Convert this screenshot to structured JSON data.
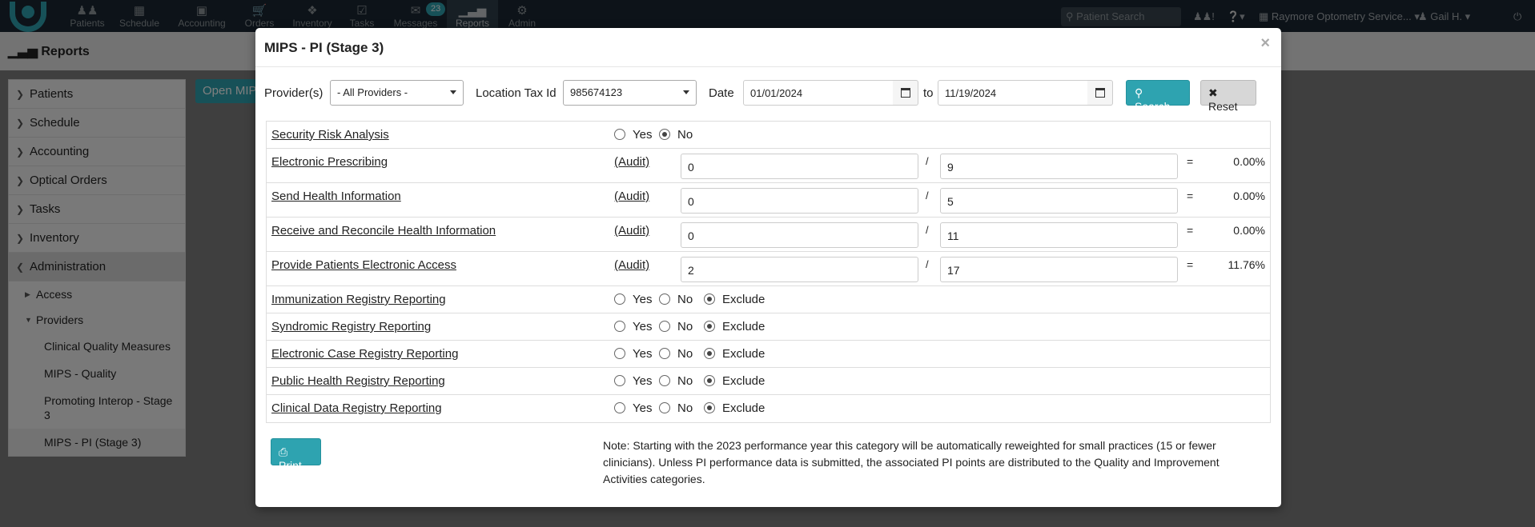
{
  "nav": {
    "items": [
      {
        "label": "Patients"
      },
      {
        "label": "Schedule"
      },
      {
        "label": "Accounting"
      },
      {
        "label": "Orders"
      },
      {
        "label": "Inventory"
      },
      {
        "label": "Tasks"
      },
      {
        "label": "Messages"
      },
      {
        "label": "Reports"
      },
      {
        "label": "Admin"
      }
    ],
    "messages_badge": "23",
    "search_placeholder": "Patient Search",
    "practice": "Raymore Optometry Service...",
    "user": "Gail H."
  },
  "page": {
    "title": "Reports",
    "open_button": "Open MIPS"
  },
  "sidebar": {
    "items": [
      {
        "label": "Patients"
      },
      {
        "label": "Schedule"
      },
      {
        "label": "Accounting"
      },
      {
        "label": "Optical Orders"
      },
      {
        "label": "Tasks"
      },
      {
        "label": "Inventory"
      },
      {
        "label": "Administration"
      }
    ],
    "sub": [
      {
        "label": "Access"
      },
      {
        "label": "Providers"
      }
    ],
    "leaves": [
      {
        "label": "Clinical Quality Measures"
      },
      {
        "label": "MIPS - Quality"
      },
      {
        "label": "Promoting Interop - Stage 3"
      },
      {
        "label": "MIPS - PI (Stage 3)"
      }
    ]
  },
  "modal": {
    "title": "MIPS - PI (Stage 3)",
    "close": "×",
    "filters": {
      "provider_label": "Provider(s)",
      "provider_value": "- All Providers -",
      "tax_label": "Location Tax Id",
      "tax_value": "985674123",
      "date_label": "Date",
      "date_from": "01/01/2024",
      "to_label": "to",
      "date_to": "11/19/2024",
      "search": "Search",
      "reset": "Reset"
    },
    "security": {
      "label": "Security Risk Analysis",
      "yes": "Yes",
      "no": "No"
    },
    "audit_label": "(Audit)",
    "measures": [
      {
        "label": "Electronic Prescribing",
        "numerator": "0",
        "denominator": "9",
        "percent": "0.00%"
      },
      {
        "label": "Send Health Information",
        "numerator": "0",
        "denominator": "5",
        "percent": "0.00%"
      },
      {
        "label": "Receive and Reconcile Health Information",
        "numerator": "0",
        "denominator": "11",
        "percent": "0.00%"
      },
      {
        "label": "Provide Patients Electronic Access",
        "numerator": "2",
        "denominator": "17",
        "percent": "11.76%"
      }
    ],
    "registries": [
      {
        "label": "Immunization Registry Reporting"
      },
      {
        "label": "Syndromic Registry Reporting"
      },
      {
        "label": "Electronic Case Registry Reporting"
      },
      {
        "label": "Public Health Registry Reporting"
      },
      {
        "label": "Clinical Data Registry Reporting"
      }
    ],
    "opt_yes": "Yes",
    "opt_no": "No",
    "opt_exclude": "Exclude",
    "print": "Print",
    "note": "Note: Starting with the 2023 performance year this category will be automatically reweighted for small practices (15 or fewer clinicians). Unless PI performance data is submitted, the associated PI points are distributed to the Quality and Improvement Activities categories."
  }
}
